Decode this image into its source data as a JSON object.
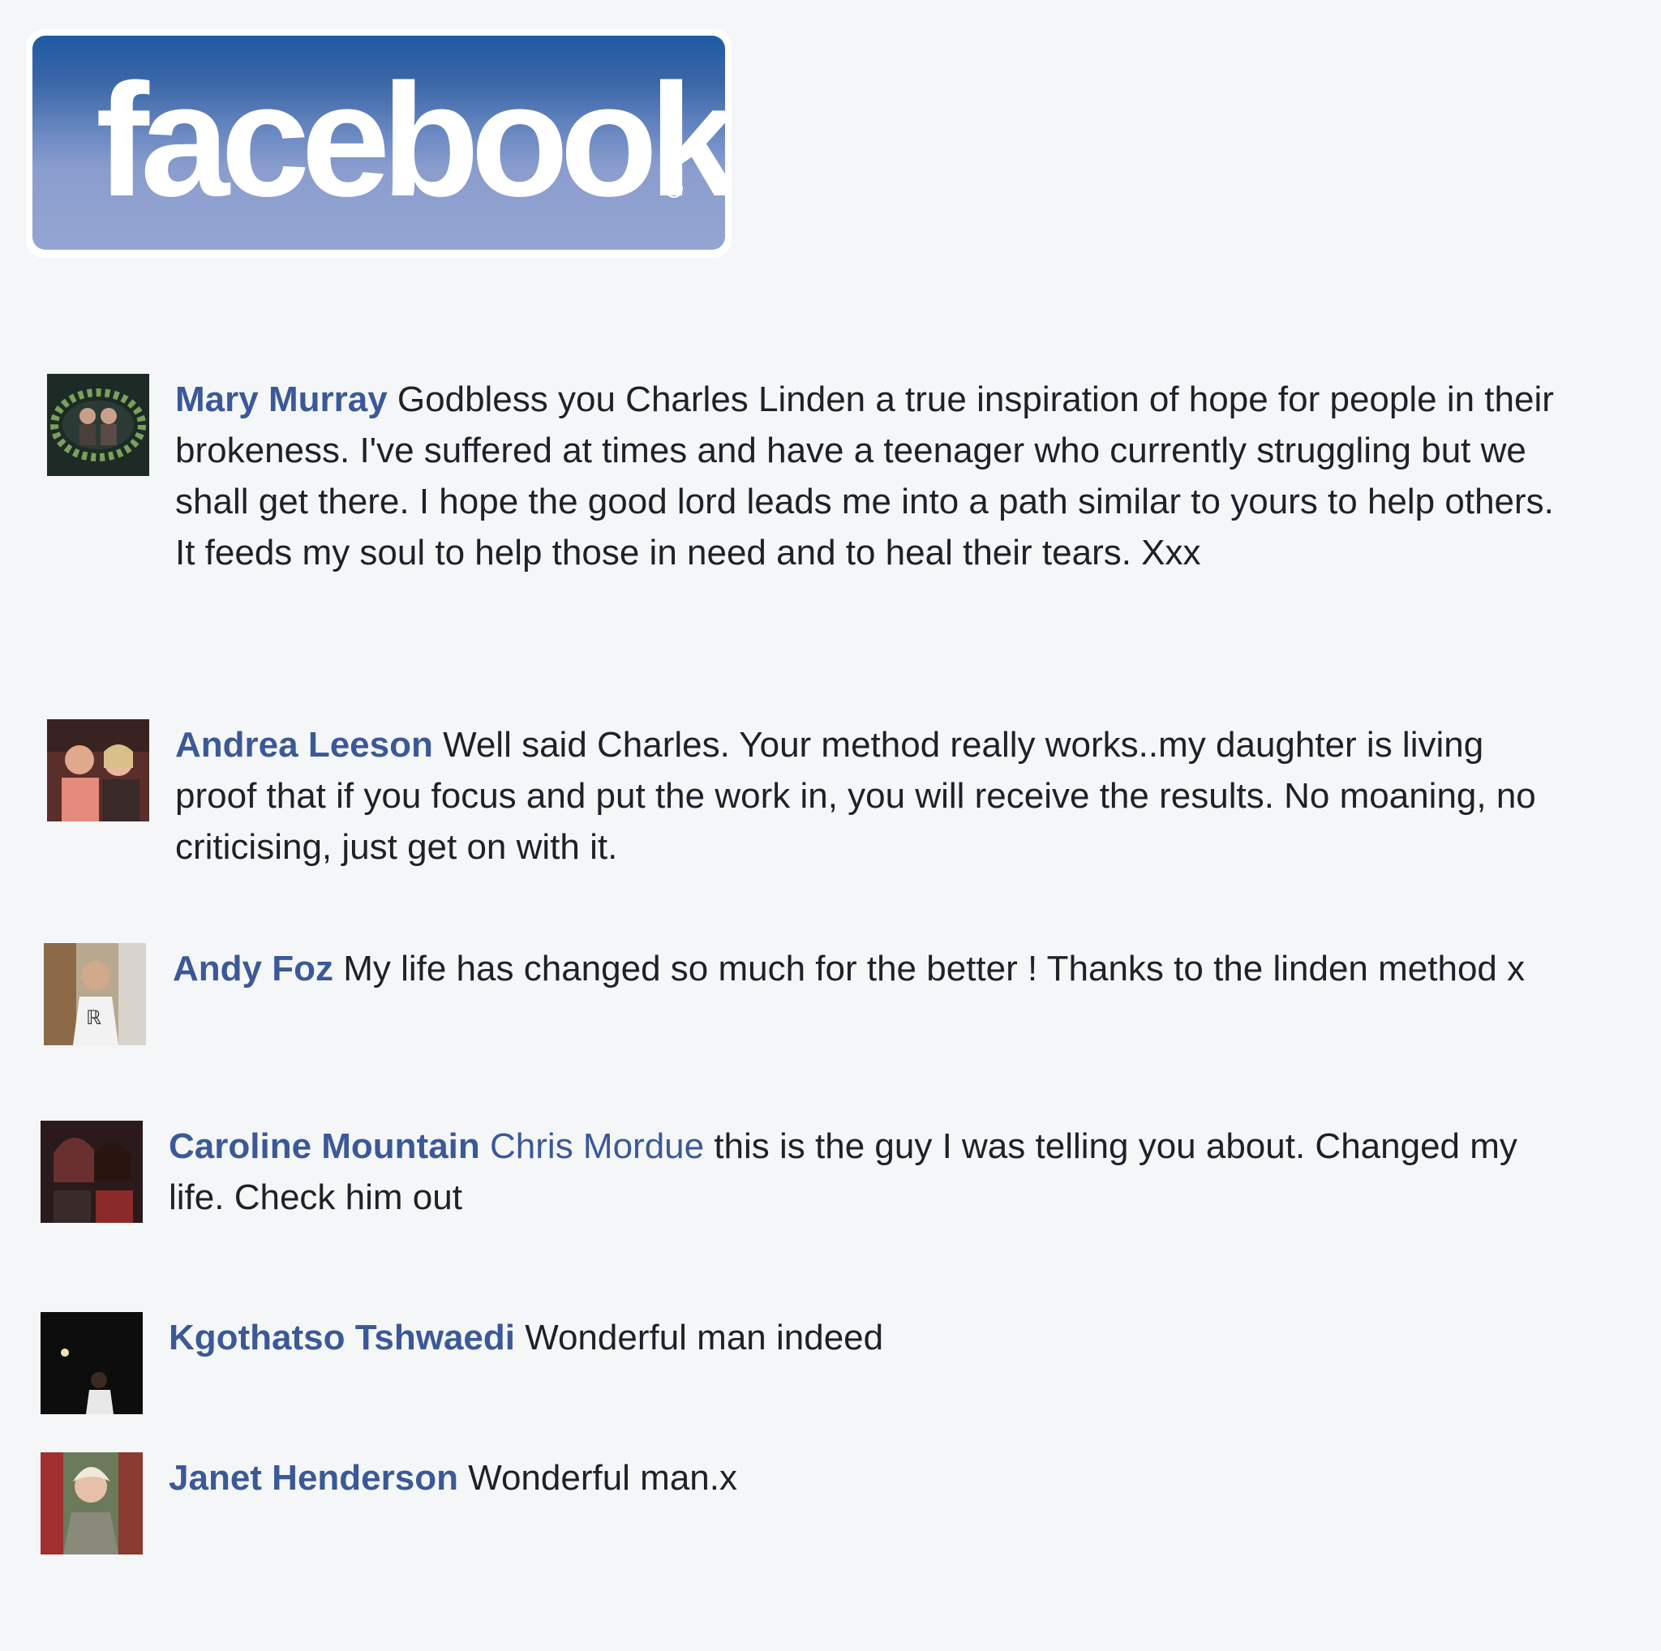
{
  "brand": {
    "logo_text": "facebook",
    "registered_mark": "®"
  },
  "comments": [
    {
      "author": "Mary Murray",
      "mention": "",
      "text": " Godbless you Charles Linden a true inspiration of hope for people in their brokeness. I've suffered at times and have a teenager who currently struggling but we shall get there. I hope the good lord leads me into a path similar to yours to help others. It feeds my soul to help those in need and to heal their tears. Xxx"
    },
    {
      "author": "Andrea Leeson",
      "mention": "",
      "text": " Well said Charles. Your method really works..my daughter is living proof that if you focus and put the work in, you will receive the results. No moaning, no criticising, just get on with it."
    },
    {
      "author": "Andy Foz",
      "mention": "",
      "text": " My life has changed so much for the better ! Thanks to the linden method x"
    },
    {
      "author": "Caroline Mountain",
      "mention": "Chris Mordue",
      "text": " this is the guy I was telling you about. Changed my life. Check him out"
    },
    {
      "author": "Kgothatso Tshwaedi",
      "mention": "",
      "text": " Wonderful man indeed"
    },
    {
      "author": "Janet Henderson",
      "mention": "",
      "text": " Wonderful man.x"
    }
  ]
}
